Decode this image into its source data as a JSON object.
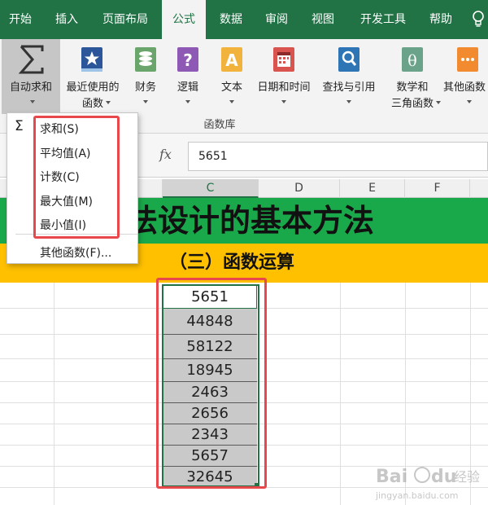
{
  "ribbon_tabs": [
    "开始",
    "插入",
    "页面布局",
    "公式",
    "数据",
    "审阅",
    "视图",
    "开发工具",
    "帮助"
  ],
  "active_tab": "公式",
  "ribbon_buttons": [
    {
      "line1": "自动求和",
      "line2": "",
      "icon": "sigma-icon"
    },
    {
      "line1": "最近使用的",
      "line2": "函数",
      "icon": "star-book-icon"
    },
    {
      "line1": "财务",
      "line2": "",
      "icon": "coins-book-icon"
    },
    {
      "line1": "逻辑",
      "line2": "",
      "icon": "question-book-icon"
    },
    {
      "line1": "文本",
      "line2": "",
      "icon": "letter-a-book-icon"
    },
    {
      "line1": "日期和时间",
      "line2": "",
      "icon": "calendar-book-icon"
    },
    {
      "line1": "查找与引用",
      "line2": "",
      "icon": "magnifier-book-icon"
    },
    {
      "line1": "数学和",
      "line2": "三角函数",
      "icon": "theta-book-icon"
    },
    {
      "line1": "其他函数",
      "line2": "",
      "icon": "more-book-icon"
    }
  ],
  "ribbon_group_label": "函数库",
  "autosum_menu": {
    "items": [
      "求和(S)",
      "平均值(A)",
      "计数(C)",
      "最大值(M)",
      "最小值(I)"
    ],
    "more": "其他函数(F)..."
  },
  "formula_bar": {
    "fx": "fx",
    "value": "5651"
  },
  "columns": [
    {
      "label": "C"
    },
    {
      "label": "D"
    },
    {
      "label": "E"
    },
    {
      "label": "F"
    }
  ],
  "sheet": {
    "title": "法设计的基本方法",
    "subtitle": "（三）函数运算"
  },
  "column_c_values": [
    "5651",
    "44848",
    "58122",
    "18945",
    "2463",
    "2656",
    "2343",
    "5657",
    "32645"
  ],
  "watermark": {
    "text": "Bai du 经验",
    "url_text": "jingyan.baidu.com"
  },
  "colors": {
    "tab_bar": "#217346",
    "title_band": "#1aa94a",
    "subtitle_band": "#ffc000",
    "highlight": "#e8474c"
  }
}
